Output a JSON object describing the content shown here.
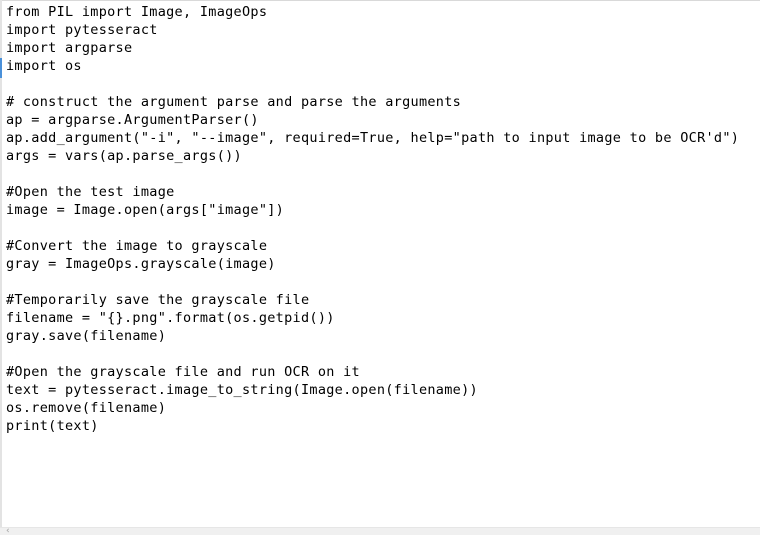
{
  "editor": {
    "lines": [
      "from PIL import Image, ImageOps",
      "import pytesseract",
      "import argparse",
      "import os",
      "",
      "# construct the argument parse and parse the arguments",
      "ap = argparse.ArgumentParser()",
      "ap.add_argument(\"-i\", \"--image\", required=True, help=\"path to input image to be OCR'd\")",
      "args = vars(ap.parse_args())",
      "",
      "#Open the test image",
      "image = Image.open(args[\"image\"])",
      "",
      "#Convert the image to grayscale",
      "gray = ImageOps.grayscale(image)",
      "",
      "#Temporarily save the grayscale file",
      "filename = \"{}.png\".format(os.getpid())",
      "gray.save(filename)",
      "",
      "#Open the grayscale file and run OCR on it",
      "text = pytesseract.image_to_string(Image.open(filename))",
      "os.remove(filename)",
      "print(text)"
    ]
  },
  "icons": {
    "scroll_left": "chevron-left-icon"
  },
  "colors": {
    "background": "#ffffff",
    "text": "#000000",
    "caret_marker": "#4a90d9"
  }
}
